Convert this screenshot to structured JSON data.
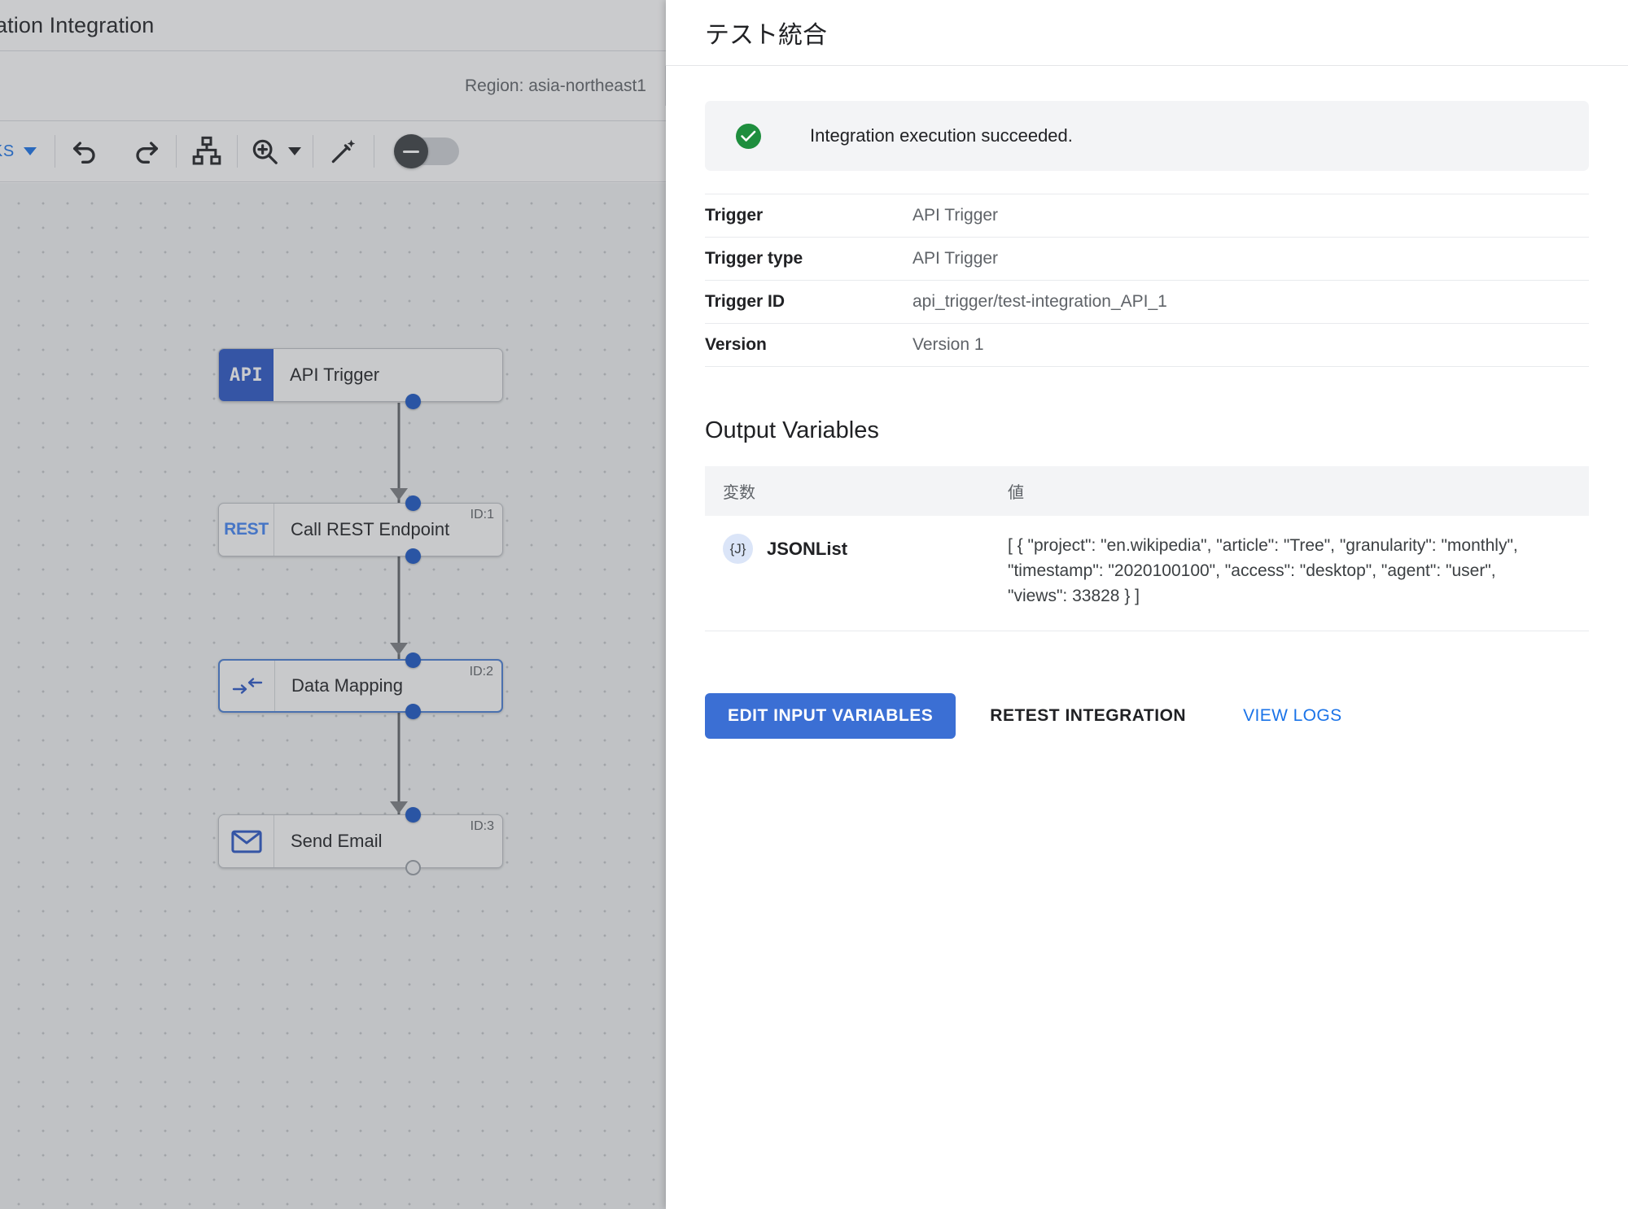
{
  "app": {
    "title": "pplication Integration",
    "region_label": "Region: asia-northeast1",
    "toolbar": {
      "tasks_label": "ASKS",
      "undo_icon": "undo-icon",
      "redo_icon": "redo-icon",
      "layout_icon": "auto-layout-icon",
      "zoom_icon": "zoom-in-icon",
      "zoom_caret_icon": "chevron-down-icon",
      "magic_icon": "magic-wand-icon",
      "toggle_state": "off"
    }
  },
  "canvas": {
    "nodes": [
      {
        "icon": "api-icon",
        "icon_text": "API",
        "label": "API Trigger",
        "id_badge": ""
      },
      {
        "icon": "rest-icon",
        "icon_text": "REST",
        "label": "Call REST Endpoint",
        "id_badge": "ID:1"
      },
      {
        "icon": "data-mapping-icon",
        "icon_text": "",
        "label": "Data Mapping",
        "id_badge": "ID:2"
      },
      {
        "icon": "envelope-icon",
        "icon_text": "",
        "label": "Send Email",
        "id_badge": "ID:3"
      }
    ]
  },
  "panel": {
    "title": "テスト統合",
    "status": {
      "icon": "check-circle-icon",
      "message": "Integration execution succeeded."
    },
    "details": [
      {
        "key": "Trigger",
        "value": "API Trigger"
      },
      {
        "key": "Trigger type",
        "value": "API Trigger"
      },
      {
        "key": "Trigger ID",
        "value": "api_trigger/test-integration_API_1"
      },
      {
        "key": "Version",
        "value": "Version 1"
      }
    ],
    "output_variables": {
      "heading": "Output Variables",
      "columns": {
        "variable": "変数",
        "value": "値"
      },
      "rows": [
        {
          "badge": "{J}",
          "name": "JSONList",
          "value": "[ { \"project\": \"en.wikipedia\", \"article\": \"Tree\", \"granularity\": \"monthly\", \"timestamp\": \"2020100100\", \"access\": \"desktop\", \"agent\": \"user\", \"views\": 33828 } ]"
        }
      ]
    },
    "actions": {
      "edit_input_variables": "EDIT INPUT VARIABLES",
      "retest_integration": "RETEST INTEGRATION",
      "view_logs": "VIEW LOGS"
    }
  },
  "colors": {
    "primary_blue": "#3b6fd4",
    "link_blue": "#1a73e8",
    "success_green": "#1e8e3e",
    "node_blue": "#2a56c6",
    "port_blue": "#1a56c4"
  }
}
